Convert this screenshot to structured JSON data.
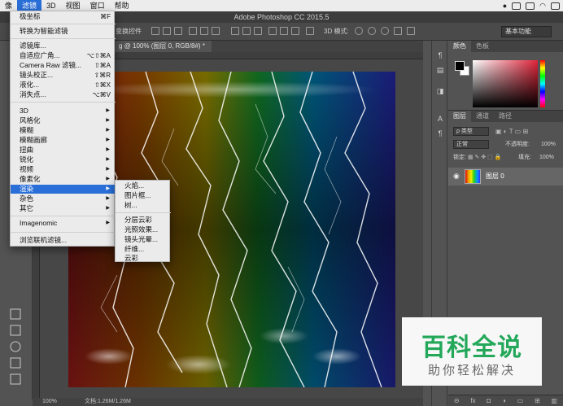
{
  "menubar": {
    "items": [
      "像",
      "滤镜",
      "3D",
      "视图",
      "窗口",
      "帮助"
    ],
    "active_index": 1
  },
  "window": {
    "title": "Adobe Photoshop CC 2015.5"
  },
  "options": {
    "transform_label": "变换控件",
    "mode_3d_label": "3D 模式:",
    "workspace": "基本功能"
  },
  "document": {
    "tab_title": "g @ 100% (图层 0, RGB/8#) *",
    "zoom": "100%",
    "doc_info": "文档:1.26M/1.26M"
  },
  "filter_menu": {
    "items": [
      {
        "label": "极坐标",
        "shortcut": "⌘F"
      },
      {
        "label": "转换为智能滤镜"
      },
      {
        "label": "滤镜库..."
      },
      {
        "label": "自适应广角...",
        "shortcut": "⌥⇧⌘A"
      },
      {
        "label": "Camera Raw 滤镜...",
        "shortcut": "⇧⌘A"
      },
      {
        "label": "镜头校正...",
        "shortcut": "⇧⌘R"
      },
      {
        "label": "液化...",
        "shortcut": "⇧⌘X"
      },
      {
        "label": "消失点...",
        "shortcut": "⌥⌘V"
      },
      {
        "label": "3D",
        "submenu": true
      },
      {
        "label": "风格化",
        "submenu": true
      },
      {
        "label": "模糊",
        "submenu": true
      },
      {
        "label": "模糊画廊",
        "submenu": true
      },
      {
        "label": "扭曲",
        "submenu": true
      },
      {
        "label": "锐化",
        "submenu": true
      },
      {
        "label": "视频",
        "submenu": true
      },
      {
        "label": "像素化",
        "submenu": true
      },
      {
        "label": "渲染",
        "submenu": true,
        "highlighted": true
      },
      {
        "label": "杂色",
        "submenu": true
      },
      {
        "label": "其它",
        "submenu": true
      },
      {
        "label": "Imagenomic",
        "submenu": true
      },
      {
        "label": "浏览联机滤镜..."
      }
    ]
  },
  "render_submenu": {
    "items": [
      "火焰...",
      "图片框...",
      "树...",
      "分层云彩",
      "光照效果...",
      "镜头光晕...",
      "纤维...",
      "云彩"
    ]
  },
  "color_panel": {
    "tabs": [
      "颜色",
      "色板"
    ]
  },
  "layers_panel": {
    "tabs": [
      "图层",
      "通道",
      "路径"
    ],
    "filter_kind": "ρ 类型",
    "blend_mode": "正常",
    "opacity_label": "不透明度:",
    "opacity": "100%",
    "lock_label": "锁定:",
    "fill_label": "填充:",
    "fill": "100%",
    "layer_name": "图层 0"
  },
  "watermark": {
    "title": "百科全说",
    "subtitle": "助你轻松解决"
  }
}
